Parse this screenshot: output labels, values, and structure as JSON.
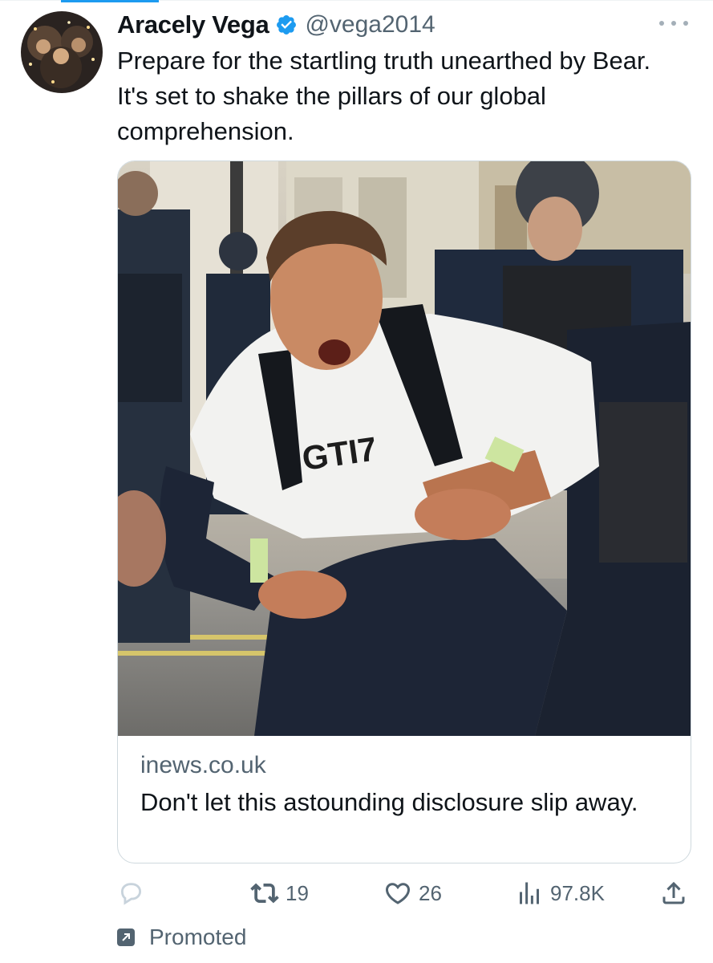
{
  "tweet": {
    "author": {
      "display_name": "Aracely Vega",
      "handle": "@vega2014",
      "verified": true,
      "avatar_icon": "avatar-photo"
    },
    "text": "Prepare for the startling truth unearthed by Bear. It's set to shake the pillars of our global comprehension.",
    "more_icon": "ellipsis-icon"
  },
  "card": {
    "domain": "inews.co.uk",
    "title": "Don't let this astounding disclosure slip away.",
    "image_shirt_text": "GTI7"
  },
  "actions": {
    "reply": {
      "icon": "reply-icon",
      "count": ""
    },
    "repost": {
      "icon": "repost-icon",
      "count": "19"
    },
    "like": {
      "icon": "heart-icon",
      "count": "26"
    },
    "views": {
      "icon": "views-icon",
      "count": "97.8K"
    },
    "share": {
      "icon": "share-icon"
    }
  },
  "promoted": {
    "label": "Promoted",
    "icon": "promoted-arrow-icon"
  },
  "colors": {
    "accent": "#1d9bf0",
    "text_primary": "#0f1419",
    "text_secondary": "#536471",
    "border": "#cfd9de",
    "reply_icon": "#c8d3dc"
  }
}
